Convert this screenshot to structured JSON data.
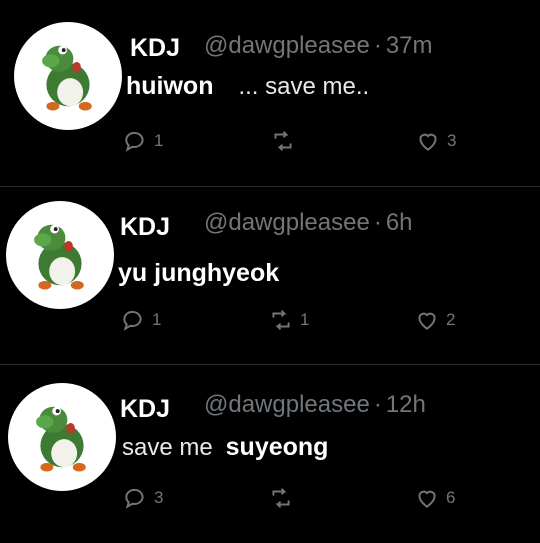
{
  "tweets": [
    {
      "display_name": "KDJ",
      "handle": "@dawgpleasee",
      "time": "37m",
      "overlay_text": "huiwon",
      "text": "... save me..",
      "replies": "1",
      "retweets": "",
      "likes": "3"
    },
    {
      "display_name": "KDJ",
      "handle": "@dawgpleasee",
      "time": "6h",
      "overlay_text": "yu junghyeok",
      "text": "",
      "replies": "1",
      "retweets": "1",
      "likes": "2"
    },
    {
      "display_name": "KDJ",
      "handle": "@dawgpleasee",
      "time": "12h",
      "text": "save me",
      "overlay_text": "suyeong",
      "replies": "3",
      "retweets": "",
      "likes": "6"
    }
  ],
  "separator": "·",
  "icons": {
    "reply": "reply-icon",
    "retweet": "retweet-icon",
    "like": "heart-icon",
    "avatar": "yoshi-avatar"
  }
}
